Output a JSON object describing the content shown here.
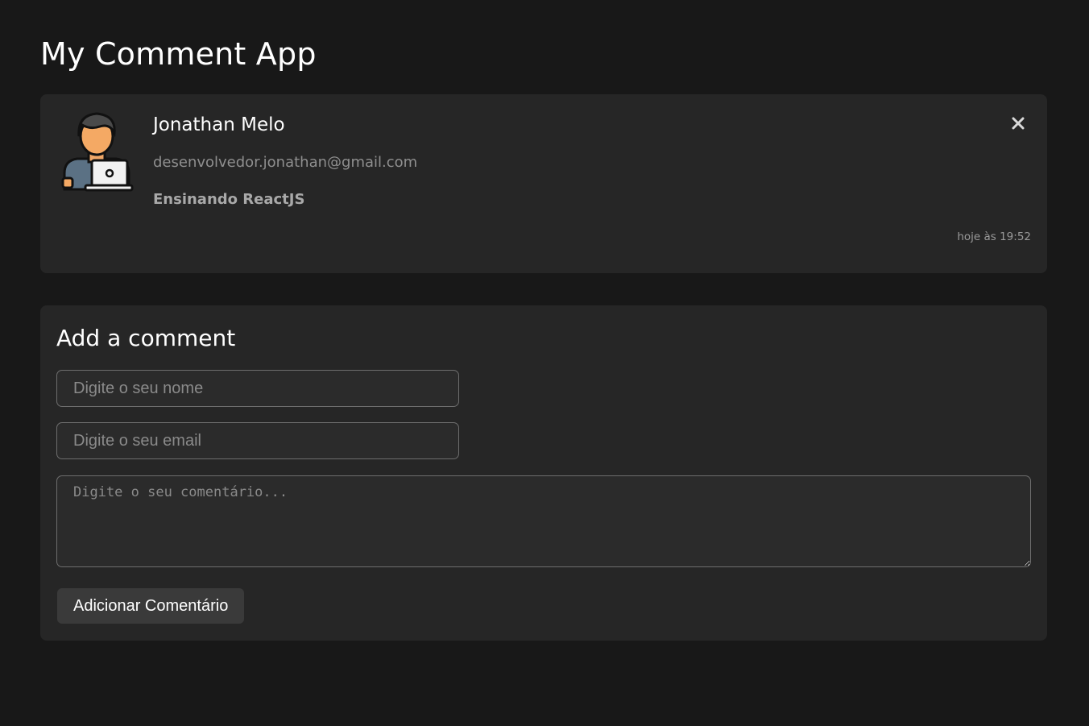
{
  "app": {
    "title": "My Comment App"
  },
  "comment": {
    "name": "Jonathan Melo",
    "email": "desenvolvedor.jonathan@gmail.com",
    "text": "Ensinando ReactJS",
    "time": "hoje às 19:52",
    "avatar_icon": "developer-avatar-icon",
    "close_icon": "close-icon"
  },
  "form": {
    "title": "Add a comment",
    "name_placeholder": "Digite o seu nome",
    "name_value": "",
    "email_placeholder": "Digite o seu email",
    "email_value": "",
    "comment_placeholder": "Digite o seu comentário...",
    "comment_value": "",
    "submit_label": "Adicionar Comentário"
  },
  "colors": {
    "background": "#181818",
    "card": "#262626",
    "input_border": "#6e6e6e",
    "button": "#3a3a3a"
  }
}
